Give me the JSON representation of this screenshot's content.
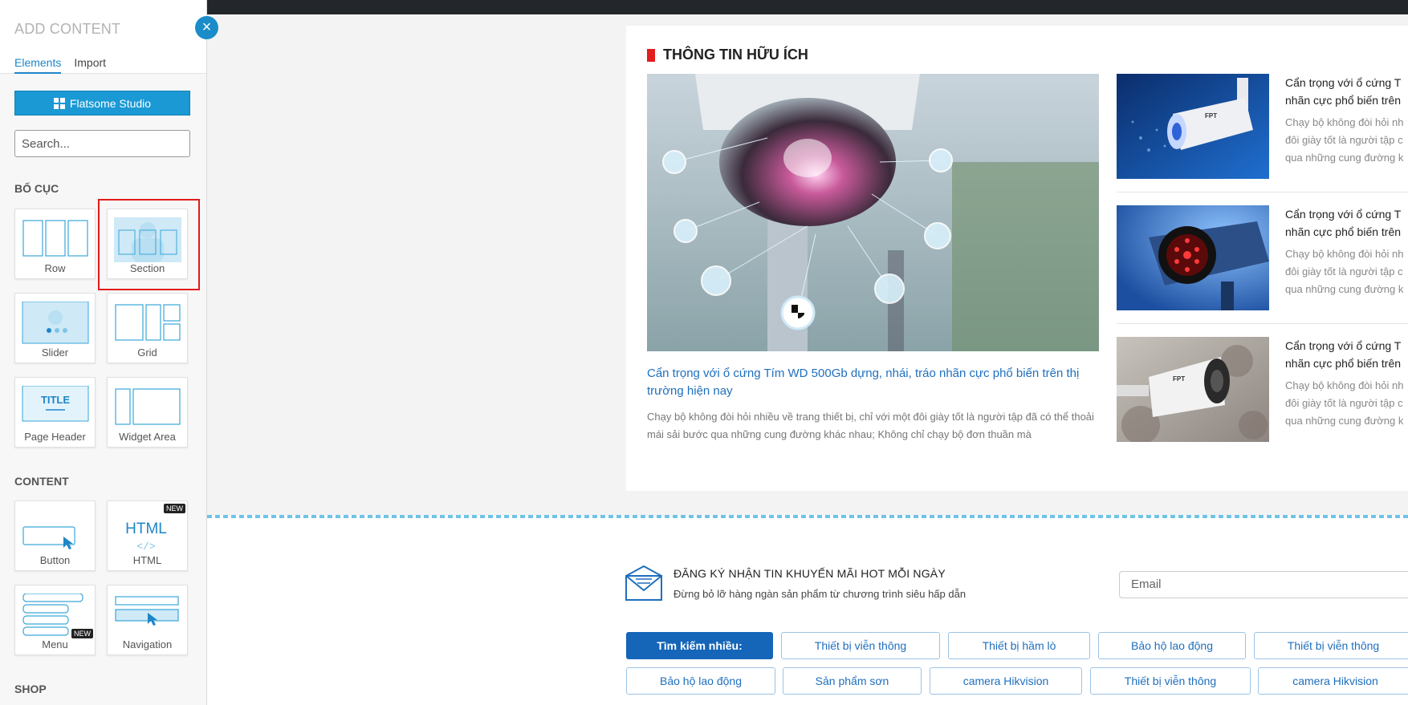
{
  "panel": {
    "title": "ADD CONTENT",
    "tabs": [
      {
        "label": "Elements",
        "active": true
      },
      {
        "label": "Import",
        "active": false
      }
    ],
    "close_symbol": "×",
    "studio_button": "Flatsome Studio",
    "search_placeholder": "Search...",
    "sections": [
      {
        "label": "BỐ CỤC",
        "items": [
          "Row",
          "Section",
          "Slider",
          "Grid",
          "Page Header",
          "Widget Area"
        ]
      },
      {
        "label": "CONTENT",
        "items": [
          "Button",
          "HTML",
          "Menu",
          "Navigation"
        ]
      },
      {
        "label": "SHOP"
      }
    ],
    "badge_new": "NEW",
    "page_header_thumb_text": "TITLE",
    "html_thumb_text": "HTML",
    "html_thumb_code": "</>"
  },
  "content": {
    "heading": "THÔNG TIN HỮU ÍCH",
    "main_post": {
      "title": "Cẩn trọng với ổ cứng Tím WD 500Gb dựng, nhái, tráo nhãn cực phổ biến trên thị trường hiện nay",
      "excerpt": "Chạy bộ không đòi hỏi nhiều về trang thiết bị, chỉ với một đôi giày tốt là người tập đã có thể thoải mái sải bước qua những cung đường khác nhau; Không chỉ chạy bộ đơn thuần mà"
    },
    "side_posts": [
      {
        "title_l1": "Cẩn trọng với ổ cứng T",
        "title_l2": "nhãn cực phổ biến trên",
        "exc_l1": "Chạy bộ không đòi hỏi nh",
        "exc_l2": "đôi giày tốt là người tập c",
        "exc_l3": "qua những cung đường k",
        "brand": "FPT"
      },
      {
        "title_l1": "Cẩn trọng với ổ cứng T",
        "title_l2": "nhãn cực phổ biến trên",
        "exc_l1": "Chạy bộ không đòi hỏi nh",
        "exc_l2": "đôi giày tốt là người tập c",
        "exc_l3": "qua những cung đường k"
      },
      {
        "title_l1": "Cẩn trọng với ổ cứng T",
        "title_l2": "nhãn cực phổ biến trên",
        "exc_l1": "Chạy bộ không đòi hỏi nh",
        "exc_l2": "đôi giày tốt là người tập c",
        "exc_l3": "qua những cung đường k",
        "brand": "FPT"
      }
    ]
  },
  "newsletter": {
    "title": "ĐĂNG KÝ NHẬN TIN KHUYẾN MÃI HOT MỖI NGÀY",
    "subtitle": "Đừng bỏ lỡ hàng ngàn sản phẩm từ chương trình siêu hấp dẫn",
    "email_placeholder": "Email"
  },
  "tags": {
    "row1": [
      "Tìm kiếm nhiều:",
      "Thiết bị viễn thông",
      "Thiết bị hầm lò",
      "Bảo hộ lao động",
      "Thiết bị viễn thông"
    ],
    "row2": [
      "Bảo hộ lao động",
      "Sản phẩm sơn",
      "camera Hikvision",
      "Thiết bị viễn thông",
      "camera Hikvision"
    ]
  },
  "colors": {
    "accent": "#1a99d4",
    "heading_bar": "#e31d1d",
    "link": "#1e6fbf",
    "highlight": "#e21b1b"
  }
}
